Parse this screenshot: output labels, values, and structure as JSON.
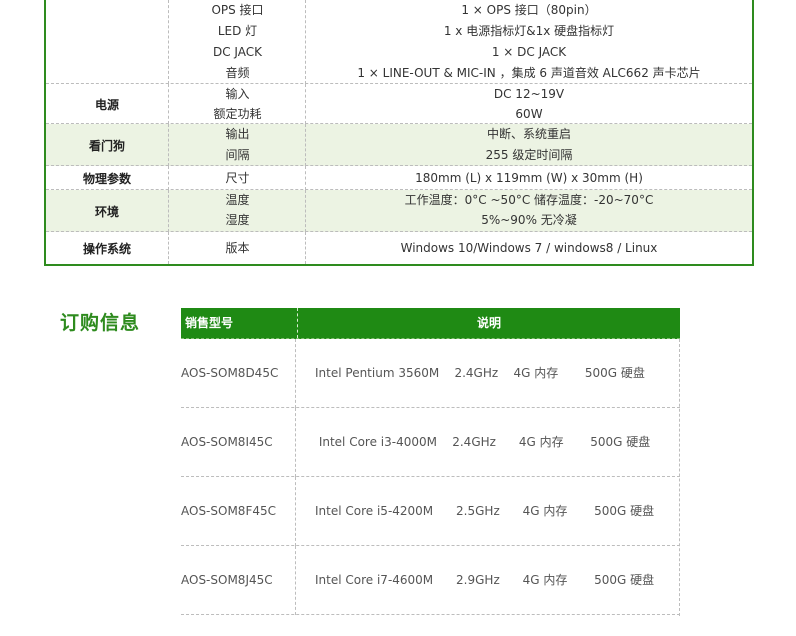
{
  "spec_table": {
    "groups": [
      {
        "category": "",
        "shaded": false,
        "rows": [
          {
            "sub": "OPS 接口",
            "value": "1 × OPS 接口（80pin）"
          },
          {
            "sub": "LED 灯",
            "value": "1 x 电源指标灯&1x 硬盘指标灯"
          },
          {
            "sub": "DC JACK",
            "value": "1 × DC JACK"
          },
          {
            "sub": "音频",
            "value": "1 × LINE-OUT &  MIC-IN ，集成 6 声道音效 ALC662 声卡芯片"
          }
        ]
      },
      {
        "category": "电源",
        "shaded": false,
        "rows": [
          {
            "sub": "输入",
            "value": "DC   12~19V"
          },
          {
            "sub": "额定功耗",
            "value": "60W"
          }
        ]
      },
      {
        "category": "看门狗",
        "shaded": true,
        "rows": [
          {
            "sub": "输出",
            "value": "中断、系统重启"
          },
          {
            "sub": "间隔",
            "value": "255 级定时间隔"
          }
        ]
      },
      {
        "category": "物理参数",
        "shaded": false,
        "rows": [
          {
            "sub": "尺寸",
            "value": "180mm (L) x 119mm (W) x 30mm (H)"
          }
        ]
      },
      {
        "category": "环境",
        "shaded": true,
        "rows": [
          {
            "sub": "温度",
            "value": "工作温度：0°C ~50°C     储存温度：-20~70°C"
          },
          {
            "sub": "湿度",
            "value": "5%~90% 无冷凝"
          }
        ]
      },
      {
        "category": "操作系统",
        "shaded": false,
        "rows": [
          {
            "sub": "版本",
            "value": "Windows 10/Windows 7 / windows8 / Linux"
          }
        ]
      }
    ]
  },
  "ordering": {
    "heading": "订购信息",
    "header_model": "销售型号",
    "header_desc": "说明",
    "rows": [
      {
        "model": "AOS-SOM8D45C",
        "desc": "Intel Pentium 3560M    2.4GHz    4G 内存       500G 硬盘"
      },
      {
        "model": "AOS-SOM8I45C",
        "desc": " Intel Core i3-4000M    2.4GHz      4G 内存       500G 硬盘"
      },
      {
        "model": "AOS-SOM8F45C",
        "desc": "Intel Core i5-4200M      2.5GHz      4G 内存       500G 硬盘"
      },
      {
        "model": "AOS-SOM8J45C",
        "desc": "Intel Core i7-4600M      2.9GHz      4G 内存       500G 硬盘"
      }
    ]
  }
}
